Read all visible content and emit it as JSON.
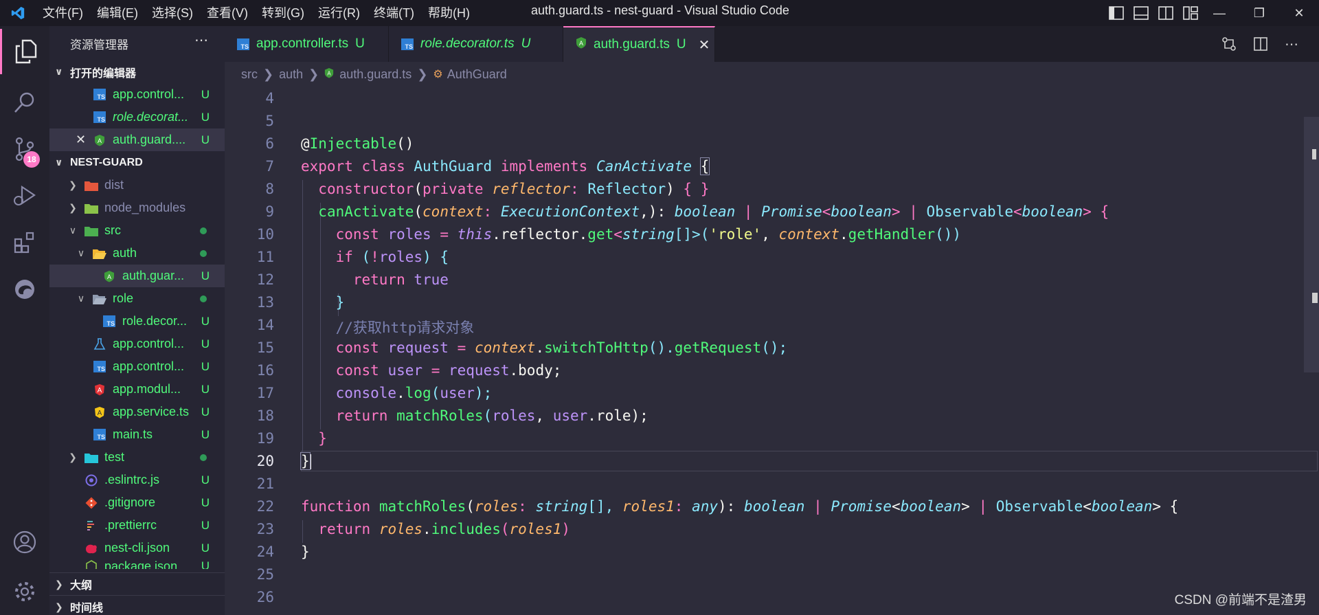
{
  "titlebar": {
    "menu": [
      "文件(F)",
      "编辑(E)",
      "选择(S)",
      "查看(V)",
      "转到(G)",
      "运行(R)",
      "终端(T)",
      "帮助(H)"
    ],
    "window_title": "auth.guard.ts - nest-guard - Visual Studio Code"
  },
  "activity": {
    "scm_badge": "18"
  },
  "sidebar": {
    "title": "资源管理器",
    "open_editors_label": "打开的编辑器",
    "open_editors": [
      {
        "name": "app.control...",
        "status": "U"
      },
      {
        "name": "role.decorat...",
        "status": "U"
      },
      {
        "name": "auth.guard....",
        "status": "U"
      }
    ],
    "project_label": "NEST-GUARD",
    "tree": [
      {
        "name": "dist",
        "status": ""
      },
      {
        "name": "node_modules",
        "status": ""
      },
      {
        "name": "src",
        "status": ""
      },
      {
        "name": "auth",
        "status": ""
      },
      {
        "name": "auth.guar...",
        "status": "U"
      },
      {
        "name": "role",
        "status": ""
      },
      {
        "name": "role.decor...",
        "status": "U"
      },
      {
        "name": "app.control...",
        "status": "U"
      },
      {
        "name": "app.control...",
        "status": "U"
      },
      {
        "name": "app.modul...",
        "status": "U"
      },
      {
        "name": "app.service.ts",
        "status": "U"
      },
      {
        "name": "main.ts",
        "status": "U"
      },
      {
        "name": "test",
        "status": ""
      },
      {
        "name": ".eslintrc.js",
        "status": "U"
      },
      {
        "name": ".gitignore",
        "status": "U"
      },
      {
        "name": ".prettierrc",
        "status": "U"
      },
      {
        "name": "nest-cli.json",
        "status": "U"
      },
      {
        "name": "package.json",
        "status": "U"
      }
    ],
    "outline_label": "大纲",
    "timeline_label": "时间线"
  },
  "tabs": [
    {
      "label": "app.controller.ts",
      "status": "U"
    },
    {
      "label": "role.decorator.ts",
      "status": "U"
    },
    {
      "label": "auth.guard.ts",
      "status": "U"
    }
  ],
  "breadcrumb": [
    "src",
    "auth",
    "auth.guard.ts",
    "AuthGuard"
  ],
  "editor": {
    "line_numbers": [
      "4",
      "5",
      "6",
      "7",
      "8",
      "9",
      "10",
      "11",
      "12",
      "13",
      "14",
      "15",
      "16",
      "17",
      "18",
      "19",
      "20",
      "21",
      "22",
      "23",
      "24",
      "25",
      "26"
    ],
    "code": {
      "l6a": "@",
      "l6b": "Injectable",
      "l6c": "()",
      "l7a": "export",
      "l7b": "class",
      "l7c": "AuthGuard",
      "l7d": "implements",
      "l7e": "CanActivate",
      "l7f": "{",
      "l8a": "constructor",
      "l8b": "(",
      "l8c": "private",
      "l8d": "reflector",
      "l8e": ":",
      "l8f": "Reflector",
      "l8g": ")",
      "l8h": "{ }",
      "l9a": "canActivate",
      "l9b": "(",
      "l9c": "context",
      "l9d": ":",
      "l9e": "ExecutionContext",
      "l9f": ",):",
      "l9g": "boolean",
      "l9h": "|",
      "l9i": "Promise",
      "l9j": "<",
      "l9k": "boolean",
      "l9l": ">",
      "l9m": "|",
      "l9n": "Observable",
      "l9o": "<",
      "l9p": "boolean",
      "l9q": ">",
      "l9r": "{",
      "l10a": "const",
      "l10b": "roles",
      "l10c": "=",
      "l10d": "this",
      "l10e": ".reflector.",
      "l10f": "get",
      "l10g": "<",
      "l10h": "string",
      "l10i": "[]",
      "l10j": ">(",
      "l10k": "'role'",
      "l10l": ", ",
      "l10m": "context",
      "l10n": ".",
      "l10o": "getHandler",
      "l10p": "())",
      "l11a": "if",
      "l11b": "(",
      "l11c": "!",
      "l11d": "roles",
      "l11e": ")",
      "l11f": "{",
      "l12a": "return",
      "l12b": "true",
      "l13a": "}",
      "l14a": "//获取http请求对象",
      "l15a": "const",
      "l15b": "request",
      "l15c": "=",
      "l15d": "context",
      "l15e": ".",
      "l15f": "switchToHttp",
      "l15g": "().",
      "l15h": "getRequest",
      "l15i": "();",
      "l16a": "const",
      "l16b": "user",
      "l16c": "=",
      "l16d": "request",
      "l16e": ".body;",
      "l17a": "console",
      "l17b": ".",
      "l17c": "log",
      "l17d": "(",
      "l17e": "user",
      "l17f": ");",
      "l18a": "return",
      "l18b": "matchRoles",
      "l18c": "(",
      "l18d": "roles",
      "l18e": ", ",
      "l18f": "user",
      "l18g": ".role);",
      "l19a": "}",
      "l20a": "}",
      "l22a": "function",
      "l22b": "matchRoles",
      "l22c": "(",
      "l22d": "roles",
      "l22e": ":",
      "l22f": "string",
      "l22g": "[],",
      "l22h": "roles1",
      "l22i": ":",
      "l22j": "any",
      "l22k": "):",
      "l22l": "boolean",
      "l22m": "|",
      "l22n": "Promise",
      "l22o": "<",
      "l22p": "boolean",
      "l22q": ">",
      "l22r": "|",
      "l22s": "Observable",
      "l22t": "<",
      "l22u": "boolean",
      "l22v": ">",
      "l22w": "{",
      "l23a": "return",
      "l23b": "roles",
      "l23c": ".",
      "l23d": "includes",
      "l23e": "(",
      "l23f": "roles1",
      "l23g": ")",
      "l24a": "}"
    }
  },
  "watermark": "CSDN @前端不是渣男",
  "colors": {
    "accent": "#ff79c6",
    "untracked": "#50fa7b",
    "background": "#2d2c3a"
  }
}
